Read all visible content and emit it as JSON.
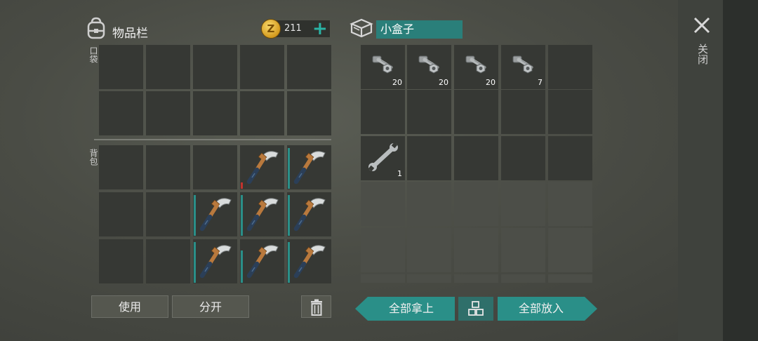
{
  "inventory": {
    "title": "物品栏",
    "coins": "211",
    "pocket_label": "口袋",
    "backpack_label": "背包",
    "use_label": "使用",
    "split_label": "分开",
    "trash_icon": "trash-icon",
    "backpack_slots": [
      null,
      null,
      null,
      {
        "icon": "pickaxe-icon",
        "durability": 0.15,
        "dcolor": "#c0332e"
      },
      {
        "icon": "pickaxe-icon",
        "durability": 0.95,
        "dcolor": "#2a8f88"
      },
      null,
      null,
      {
        "icon": "pickaxe-icon",
        "durability": 0.95,
        "dcolor": "#2a8f88"
      },
      {
        "icon": "pickaxe-icon",
        "durability": 0.95,
        "dcolor": "#2a8f88"
      },
      {
        "icon": "pickaxe-icon",
        "durability": 0.95,
        "dcolor": "#2a8f88"
      },
      null,
      null,
      {
        "icon": "pickaxe-icon",
        "durability": 0.95,
        "dcolor": "#2a8f88"
      },
      {
        "icon": "pickaxe-icon",
        "durability": 0.75,
        "dcolor": "#2a8f88"
      },
      {
        "icon": "pickaxe-icon",
        "durability": 0.95,
        "dcolor": "#2a8f88"
      }
    ]
  },
  "container": {
    "title": "小盒子",
    "take_all_label": "全部拿上",
    "put_all_label": "全部放入",
    "sort_icon": "sort-grid-icon",
    "slots": [
      {
        "icon": "bolt-nut-icon",
        "qty": "20"
      },
      {
        "icon": "bolt-nut-icon",
        "qty": "20"
      },
      {
        "icon": "bolt-nut-icon",
        "qty": "20"
      },
      {
        "icon": "bolt-nut-icon",
        "qty": "7"
      },
      null,
      null,
      null,
      null,
      null,
      null,
      {
        "icon": "wrench-icon",
        "qty": "1"
      },
      null,
      null,
      null,
      null
    ]
  },
  "close_label": "关闭"
}
